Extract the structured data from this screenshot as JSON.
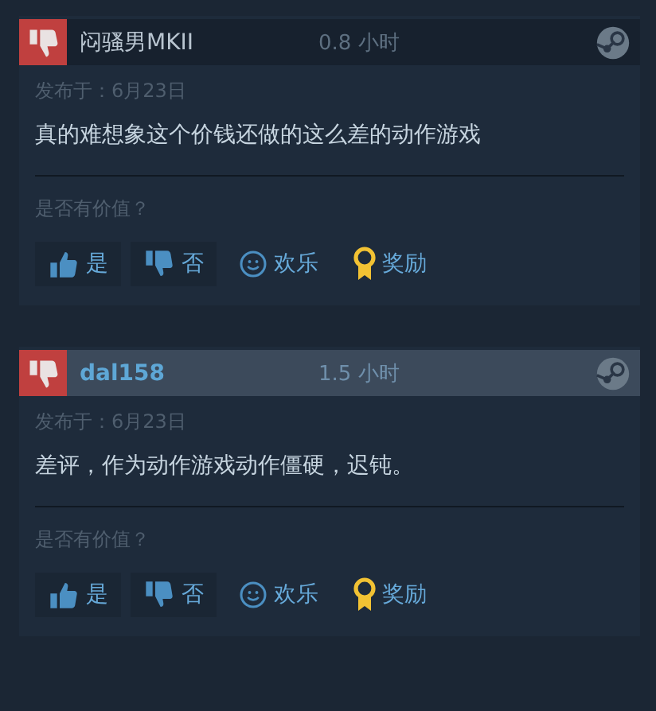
{
  "reviews": [
    {
      "author": "闷骚男MKII",
      "hours": "0.8 小时",
      "highlighted": false,
      "date": "发布于：6月23日",
      "text": "真的难想象这个价钱还做的这么差的动作游戏",
      "question": "是否有价值？",
      "buttons": [
        {
          "kind": "yes",
          "label": "是"
        },
        {
          "kind": "no",
          "label": "否"
        },
        {
          "kind": "funny",
          "label": "欢乐"
        },
        {
          "kind": "award",
          "label": "奖励"
        }
      ]
    },
    {
      "author": "dal158",
      "hours": "1.5 小时",
      "highlighted": true,
      "date": "发布于：6月23日",
      "text": "差评，作为动作游戏动作僵硬，迟钝。",
      "question": "是否有价值？",
      "buttons": [
        {
          "kind": "yes",
          "label": "是"
        },
        {
          "kind": "no",
          "label": "否"
        },
        {
          "kind": "funny",
          "label": "欢乐"
        },
        {
          "kind": "award",
          "label": "奖励"
        }
      ]
    }
  ]
}
